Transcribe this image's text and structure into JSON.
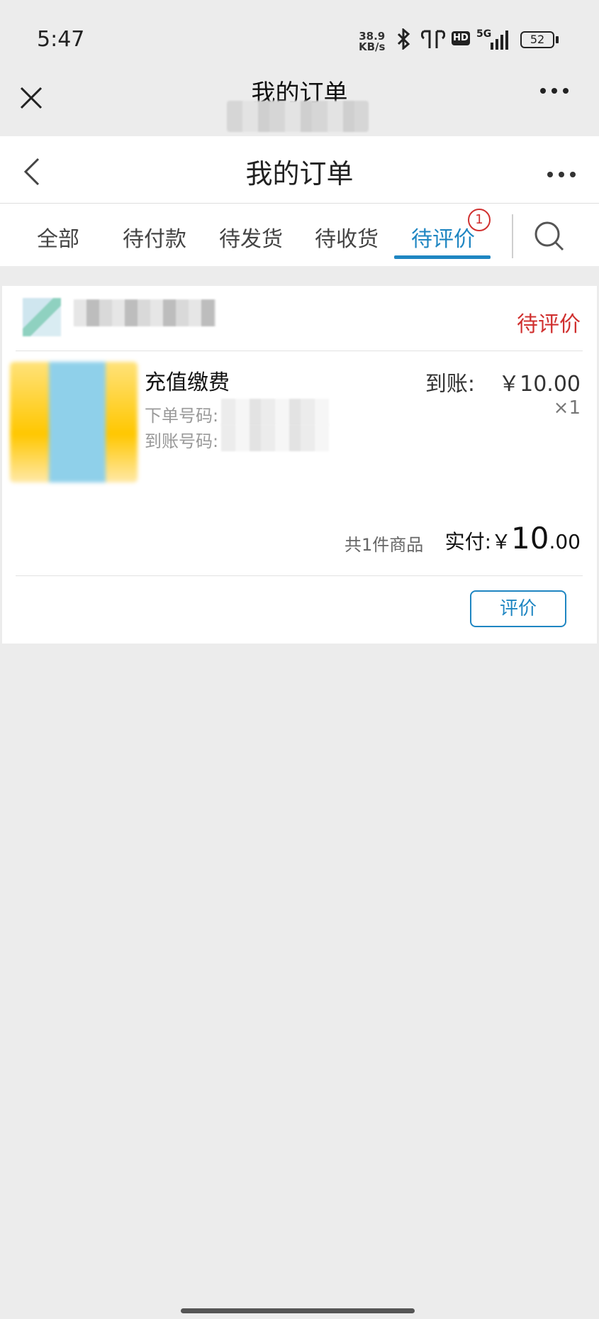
{
  "status_bar": {
    "time": "5:47",
    "network_speed_value": "38.9",
    "network_speed_unit": "KB/s",
    "hd_label": "HD",
    "signal_label": "5G",
    "battery": "52",
    "icons": [
      "bluetooth-icon",
      "earbuds-icon",
      "signal-icon",
      "battery-icon"
    ]
  },
  "mini_program": {
    "title": "我的订单",
    "close_glyph": "×",
    "more_glyph": "•••"
  },
  "nav": {
    "title": "我的订单",
    "back_glyph": "‹",
    "more_glyph": "•••"
  },
  "tabs": [
    {
      "label": "全部"
    },
    {
      "label": "待付款"
    },
    {
      "label": "待发货"
    },
    {
      "label": "待收货"
    },
    {
      "label": "待评价",
      "active": true,
      "badge": "1"
    }
  ],
  "order": {
    "status": "待评价",
    "product_name": "充值缴费",
    "order_number_label": "下单号码:",
    "recharge_number_label": "到账号码:",
    "price_label": "到账:",
    "price": "￥10.00",
    "quantity": "×1",
    "item_count_text": "共1件商品",
    "paid_label": "实付:",
    "paid_currency": "￥",
    "paid_integer": "10",
    "paid_decimal": ".00",
    "review_button": "评价"
  },
  "colors": {
    "accent": "#1f86c2",
    "status_red": "#d0302f",
    "background": "#ececec"
  }
}
